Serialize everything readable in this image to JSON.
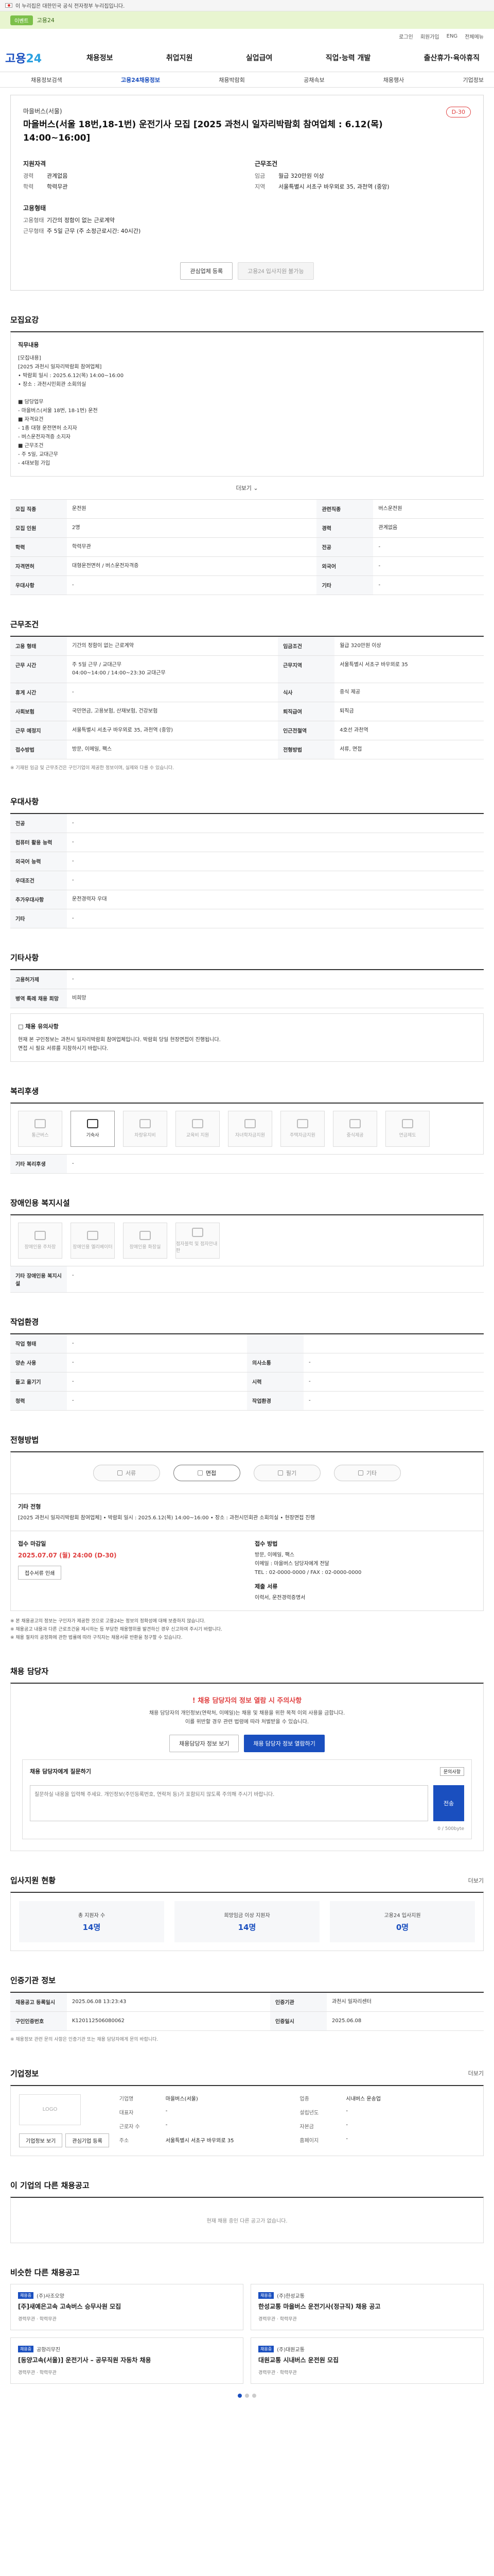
{
  "gov": {
    "text": "이 누리집은 대한민국 공식 전자정부 누리집입니다."
  },
  "promo": {
    "pill": "이벤트",
    "text": "고용24"
  },
  "util": [
    "로그인",
    "회원가입",
    "ENG",
    "전체메뉴"
  ],
  "brand": {
    "logo_main": "고용",
    "logo_sub": "24"
  },
  "menu": [
    "채용정보",
    "취업지원",
    "실업급여",
    "직업·능력 개발",
    "출산휴가·육아휴직"
  ],
  "subnav": [
    "채용정보검색",
    "고용24채용정보",
    "채용박람회",
    "공채속보",
    "채용행사",
    "기업정보"
  ],
  "job": {
    "org": "마을버스(서울)",
    "title": "마을버스(서울 18번,18-1번) 운전기사 모집 [2025 과천시 일자리박람회 참여업체 : 6.12(목) 14:00~16:00]",
    "dday": "D-30",
    "recruit_title": "지원자격",
    "career_label": "경력",
    "career": "관계없음",
    "edu_label": "학력",
    "edu": "학력무관",
    "cond_title": "근무조건",
    "region_label": "지역",
    "region": "서울특별시 서초구 바우뫼로 35, 과천역 (중앙)",
    "pay_label": "임금",
    "pay": "월급 320만원 이상",
    "emp_title": "고용형태",
    "emp_label": "고용형태",
    "emp": "기간의 정함이 없는 근로계약",
    "hours_label": "근무형태",
    "hours": "주 5일 근무 (주 소정근로시간: 40시간)",
    "btn_interest": "관심업체 등록",
    "btn_apply": "고용24 입사지원 불가능"
  },
  "recruit": {
    "section": "모집요강",
    "desc_title": "직무내용",
    "desc": "[모집내용]\n[2025 과천시 일자리박람회 참여업체]\n• 박람회 일시 : 2025.6.12(목) 14:00~16:00\n• 장소 : 과천시민회관 소회의실\n\n■ 담당업무\n - 마을버스(서울 18번, 18-1번) 운전\n■ 자격요건\n - 1종 대형 운전면허 소지자\n - 버스운전자격증 소지자\n■ 근무조건\n - 주 5일, 교대근무\n - 4대보험 가입",
    "fold": "더보기",
    "rows": [
      {
        "k": "모집 직종",
        "v": "운전원",
        "k2": "관련직종",
        "v2": "버스운전원"
      },
      {
        "k": "모집 인원",
        "v": "2명",
        "k2": "경력",
        "v2": "관계없음"
      },
      {
        "k": "학력",
        "v": "학력무관",
        "k2": "전공",
        "v2": "-"
      },
      {
        "k": "자격면허",
        "v": "대형운전면허 / 버스운전자격증",
        "k2": "외국어",
        "v2": "-"
      },
      {
        "k": "우대사항",
        "v": "-",
        "k2": "기타",
        "v2": "-"
      }
    ]
  },
  "conditions": {
    "section": "근무조건",
    "rows": [
      {
        "k": "고용 형태",
        "v": "기간의 정함이 없는 근로계약",
        "k2": "임금조건",
        "v2": "월급 320만원 이상"
      },
      {
        "k": "근무 시간",
        "v": "주 5일 근무 / 교대근무\n04:00~14:00 / 14:00~23:30 교대근무",
        "k2": "근무지역",
        "v2": "서울특별시 서초구 바우뫼로 35"
      },
      {
        "k": "휴게 시간",
        "v": "-",
        "k2": "식사",
        "v2": "중식 제공"
      },
      {
        "k": "사회보험",
        "v": "국민연금, 고용보험, 산재보험, 건강보험",
        "k2": "퇴직급여",
        "v2": "퇴직금"
      },
      {
        "k": "근무 예정지",
        "v": "서울특별시 서초구 바우뫼로 35, 과천역 (중앙)",
        "k2": "인근전철역",
        "v2": "4호선 과천역"
      },
      {
        "k": "접수방법",
        "v": "방문, 이메일, 팩스",
        "k2": "전형방법",
        "v2": "서류, 면접"
      }
    ],
    "note": "※ 기재된 임금 및 근무조건은 구인기업이 제공한 정보이며, 실제와 다를 수 있습니다."
  },
  "extra": {
    "section": "우대사항",
    "rows": [
      {
        "k": "전공",
        "v": "-"
      },
      {
        "k": "컴퓨터 활용 능력",
        "v": "-"
      },
      {
        "k": "외국어 능력",
        "v": "-"
      },
      {
        "k": "우대조건",
        "v": "-"
      },
      {
        "k": "추가우대사항",
        "v": "운전경력자 우대"
      },
      {
        "k": "기타",
        "v": "-"
      }
    ]
  },
  "other": {
    "section": "기타사항",
    "rows": [
      {
        "k": "고용허가제",
        "v": "-"
      },
      {
        "k": "병역 특례 채용 희망",
        "v": "비희망"
      }
    ],
    "notice_title": "□ 채용 유의사항",
    "notice": "현재 본 구인정보는 과천시 일자리박람회 참여업체입니다. 박람회 당일 현장면접이 진행됩니다.\n면접 시 필요 서류를 지참하시기 바랍니다."
  },
  "welfare": {
    "section": "복리후생",
    "items": [
      {
        "label": "통근버스",
        "on": false
      },
      {
        "label": "기숙사",
        "on": true
      },
      {
        "label": "차량유지비",
        "on": false
      },
      {
        "label": "교육비 지원",
        "on": false
      },
      {
        "label": "자녀학자금지원",
        "on": false
      },
      {
        "label": "주택자금지원",
        "on": false
      },
      {
        "label": "중식제공",
        "on": false
      },
      {
        "label": "연금제도",
        "on": false
      }
    ],
    "extra_label": "기타 복리후생",
    "extra_value": "-"
  },
  "disability": {
    "section": "장애인용 복지시설",
    "items": [
      {
        "label": "장애인용 주차장",
        "on": false
      },
      {
        "label": "장애인용 엘리베이터",
        "on": false
      },
      {
        "label": "장애인용 화장실",
        "on": false
      },
      {
        "label": "점자블럭 및 점자안내판",
        "on": false
      }
    ],
    "extra_label": "기타 장애인용 복지시설",
    "extra_value": "-"
  },
  "environment": {
    "section": "작업환경",
    "rows": [
      {
        "k": "작업 형태",
        "v": "-",
        "k2": "",
        "v2": ""
      },
      {
        "k": "양손 사용",
        "v": "-",
        "k2": "의사소통",
        "v2": "-"
      },
      {
        "k": "들고 옮기기",
        "v": "-",
        "k2": "시력",
        "v2": "-"
      },
      {
        "k": "청력",
        "v": "-",
        "k2": "작업환경",
        "v2": "-"
      }
    ]
  },
  "process": {
    "section": "전형방법",
    "steps": [
      {
        "label": "서류",
        "on": false
      },
      {
        "label": "면접",
        "on": true
      },
      {
        "label": "필기",
        "on": false
      },
      {
        "label": "기타",
        "on": false
      }
    ],
    "other_title": "기타 전형",
    "other_text": "[2025 과천시 일자리박람회 참여업체] • 박람회 일시 : 2025.6.12(목) 14:00~16:00 • 장소 : 과천시민회관 소회의실 • 현장면접 진행",
    "deadline_title": "접수 마감일",
    "deadline": "2025.07.07 (월) 24:00",
    "deadline_sub": "(D-30)",
    "method_title": "접수 방법",
    "method": "방문, 이메일, 팩스\n이메일 : 마을버스 담당자에게 전달\nTEL : 02-0000-0000 / FAX : 02-0000-0000",
    "docs_title": "제출 서류",
    "docs": "이력서, 운전경력증명서",
    "print_btn": "접수서류 인쇄",
    "notices": [
      "※ 본 채용공고의 정보는 구인자가 제공한 것으로 고용24는 정보의 정확성에 대해 보증하지 않습니다.",
      "※ 채용공고 내용과 다른 근로조건을 제시하는 등 부당한 채용행위를 발견하신 경우 신고하여 주시기 바랍니다.",
      "※ 채용 절차의 공정화에 관한 법률에 따라 구직자는 채용서류 반환을 청구할 수 있습니다."
    ]
  },
  "counsel": {
    "section": "채용 담당자",
    "warn": "! 채용 담당자의 정보 열람 시 주의사항",
    "text": "채용 담당자의 개인정보(연락처, 이메일)는 채용 및 채용을 위한 목적 이외 사용을 금합니다.\n이를 위반할 경우 관련 법령에 따라 처벌받을 수 있습니다.",
    "btn_view": "채용담당자 정보 보기",
    "btn_ask": "채용 담당자 정보 열람하기",
    "input_title": "채용 담당자에게 질문하기",
    "input_tag": "문의사항",
    "placeholder": "질문하실 내용을 입력해 주세요. 개인정보(주민등록번호, 연락처 등)가 포함되지 않도록 주의해 주시기 바랍니다.",
    "send": "전송",
    "counter": "0 / 500byte"
  },
  "stats": {
    "section": "입사지원 현황",
    "more": "더보기",
    "items": [
      {
        "label": "총 지원자 수",
        "value": "14명"
      },
      {
        "label": "희망임금 이상 지원자",
        "value": "14명"
      },
      {
        "label": "고용24 입사지원",
        "value": "0명"
      }
    ]
  },
  "manager": {
    "section": "인증기관 정보",
    "rows": [
      {
        "k": "채용공고 등록일시",
        "v": "2025.06.08 13:23:43",
        "k2": "인증기관",
        "v2": "과천시 일자리센터"
      },
      {
        "k": "구인인증번호",
        "v": "K120112506080062",
        "k2": "인증일시",
        "v2": "2025.06.08"
      }
    ],
    "note": "※ 채용정보 관련 문의 사항은 인증기관 또는 채용 담당자에게 문의 바랍니다."
  },
  "company": {
    "section": "기업정보",
    "more": "더보기",
    "logo": "LOGO",
    "rows": [
      {
        "k": "기업명",
        "v": "마을버스(서울)",
        "k2": "업종",
        "v2": "시내버스 운송업"
      },
      {
        "k": "대표자",
        "v": "-",
        "k2": "설립년도",
        "v2": "-"
      },
      {
        "k": "근로자 수",
        "v": "-",
        "k2": "자본금",
        "v2": "-"
      },
      {
        "k": "주소",
        "v": "서울특별시 서초구 바우뫼로 35",
        "k2": "홈페이지",
        "v2": "-"
      }
    ],
    "btn1": "기업정보 보기",
    "btn2": "관심기업 등록"
  },
  "others_empty": {
    "section": "이 기업의 다른 채용공고",
    "text": "현재 채용 중인 다른 공고가 없습니다."
  },
  "related": {
    "section": "비슷한 다른 채용공고",
    "cards": [
      {
        "tag": "채용중",
        "org": "(주)사조오양",
        "title": "[주]새예은고속 고속버스 승무사원 모집",
        "meta": "경력무관 · 학력무관"
      },
      {
        "tag": "채용중",
        "org": "(주)한성교통",
        "title": "한성교통 마을버스 운전기사(정규직) 채용 공고",
        "meta": "경력무관 · 학력무관"
      },
      {
        "tag": "채용중",
        "org": "공항리무진",
        "title": "[동양고속(서울)] 운전기사 – 공무직원 자동차 채용",
        "meta": "경력무관 · 학력무관"
      },
      {
        "tag": "채용중",
        "org": "(주)대원교통",
        "title": "대원교통 시내버스 운전원 모집",
        "meta": "경력무관 · 학력무관"
      }
    ]
  }
}
